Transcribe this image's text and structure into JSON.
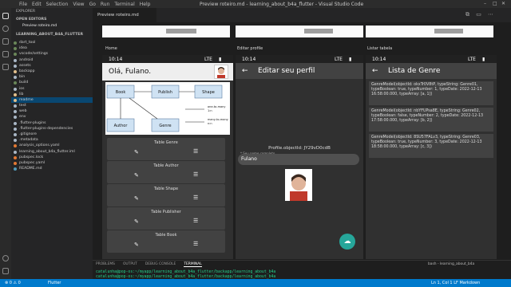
{
  "window": {
    "title": "Preview roteiro.md - learning_about_b4a_flutter - Visual Studio Code",
    "menu": [
      "File",
      "Edit",
      "Selection",
      "View",
      "Go",
      "Run",
      "Terminal",
      "Help"
    ],
    "controls": [
      "–",
      "□",
      "✕"
    ]
  },
  "sidebar": {
    "header": "EXPLORER",
    "open_editors_label": "OPEN EDITORS",
    "open_editor_file": "Preview roteiro.md",
    "project_label": "LEARNING_ABOUT_B4A_FLUTTER",
    "items": [
      {
        "label": "dart_tool",
        "color": "#6a8759"
      },
      {
        "label": "idea",
        "color": "#6a8759"
      },
      {
        "label": "vscode/settings",
        "color": "#6a8759"
      },
      {
        "label": "android",
        "color": "#a9b7c6"
      },
      {
        "label": "assets",
        "color": "#a9b7c6"
      },
      {
        "label": "backapp",
        "color": "#e2c08d"
      },
      {
        "label": "bin",
        "color": "#a9b7c6"
      },
      {
        "label": "build",
        "color": "#6a8759"
      },
      {
        "label": "ios",
        "color": "#a9b7c6"
      },
      {
        "label": "lib",
        "color": "#e2c08d"
      },
      {
        "label": "readme",
        "color": "#e2c08d"
      },
      {
        "label": "test",
        "color": "#a9b7c6"
      },
      {
        "label": "web",
        "color": "#a9b7c6"
      },
      {
        "label": "env",
        "color": "#a9b7c6"
      },
      {
        "label": ".flutter-plugins",
        "color": "#a9b7c6"
      },
      {
        "label": ".flutter-plugins-dependencies",
        "color": "#a9b7c6"
      },
      {
        "label": ".gitignore",
        "color": "#a9b7c6"
      },
      {
        "label": ".metadata",
        "color": "#a9b7c6"
      },
      {
        "label": "analysis_options.yaml",
        "color": "#e37933"
      },
      {
        "label": "learning_about_b4a_flutter.iml",
        "color": "#a9b7c6"
      },
      {
        "label": "pubspec.lock",
        "color": "#e37933"
      },
      {
        "label": "pubspec.yaml",
        "color": "#e37933"
      },
      {
        "label": "README.md",
        "color": "#519aba"
      }
    ],
    "selected_index": 10
  },
  "editor_tab": "Preview roteiro.md",
  "columns": {
    "home": "Home",
    "edit": "Editar profile",
    "list": "Listar tabela"
  },
  "phone": {
    "time": "10:14",
    "network": "LTE"
  },
  "home_screen": {
    "greeting": "Olá, Fulano.",
    "diagram": {
      "nodes": [
        "Book",
        "Publish",
        "Shape",
        "Author",
        "Genre"
      ],
      "legend_one": "one-to-many",
      "legend_one_sub": "1:n",
      "legend_many": "many-to-many",
      "legend_many_sub": "n:n"
    },
    "tables": [
      "Table Genre",
      "Table Author",
      "Table Shape",
      "Table Publisher",
      "Table Book"
    ]
  },
  "edit_screen": {
    "title": "Editar seu perfil",
    "object_id": "Profile.objectId: JY29vD0cdB",
    "field_label": "* Seu nome completo.",
    "field_value": "Fulano"
  },
  "list_screen": {
    "title": "Lista de Genre",
    "items": [
      "GenreModel(objectId: okxTr0V8tP, typeString: Genre01, typeBoolean: true, typeNumber: 1, typeDate: 2022-12-13 16:58:00.000, typeArray: [a, 1])",
      "GenreModel(objectId: nbYFUPsa8E, typeString: Genre02, typeBoolean: false, typeNumber: 2, typeDate: 2022-12-13 17:58:00.000, typeArray: [b, 2])",
      "GenreModel(objectId: 8SU57FALv3, typeString: Genre03, typeBoolean: true, typeNumber: 3, typeDate: 2022-12-13 18:58:00.000, typeArray: [c, 3])"
    ]
  },
  "panel": {
    "tabs": [
      "PROBLEMS",
      "OUTPUT",
      "DEBUG CONSOLE",
      "TERMINAL"
    ],
    "terminal_name": "bash - learning_about_b4a",
    "lines": [
      "catalunha@pop-os:~/myapp/learning_about_b4a_flutter/backapp/learning_about_b4a",
      "catalunha@pop-os:~/myapp/learning_about_b4a_flutter/backapp/learning_about_b4a"
    ]
  },
  "statusbar": {
    "left": "⊗ 0 ⚠ 0",
    "branch": "Flutter",
    "right": "Ln 1, Col 1   LF   Markdown"
  },
  "colors": {
    "accent": "#007acc",
    "fab": "#26a69a"
  }
}
